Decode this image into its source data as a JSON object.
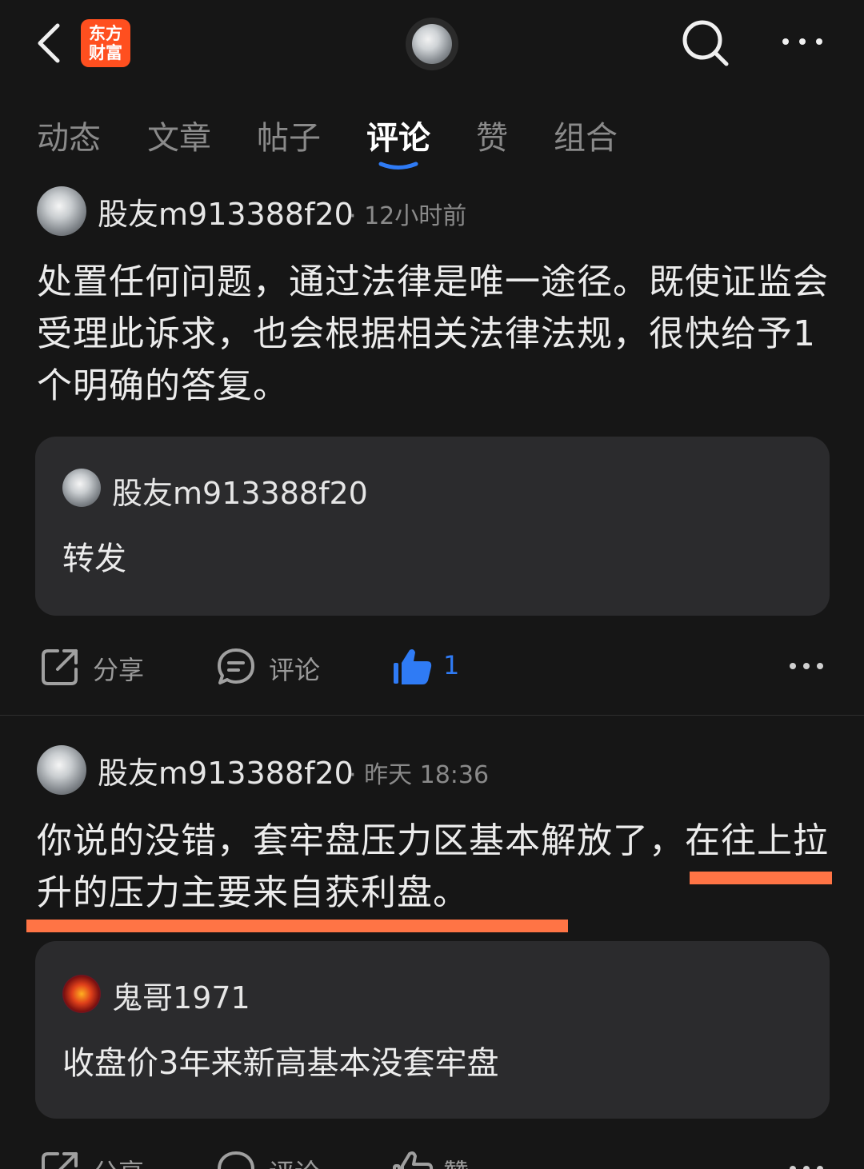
{
  "header": {
    "logo_line1": "东方",
    "logo_line2": "财富"
  },
  "tabs": [
    {
      "label": "动态"
    },
    {
      "label": "文章"
    },
    {
      "label": "帖子"
    },
    {
      "label": "评论",
      "active": true
    },
    {
      "label": "赞"
    },
    {
      "label": "组合"
    }
  ],
  "posts": [
    {
      "author": "股友m913388f20",
      "time": "· 12小时前",
      "text": "处置任何问题，通过法律是唯一途径。既使证监会受理此诉求，也会根据相关法律法规，很快给予1个明确的答复。",
      "quote": {
        "author": "股友m913388f20",
        "text": "转发"
      },
      "actions": {
        "share": "分享",
        "comment": "评论",
        "likes": "1"
      }
    },
    {
      "author": "股友m913388f20",
      "time": "· 昨天 18:36",
      "text": "你说的没错，套牢盘压力区基本解放了，在往上拉升的压力主要来自获利盘。",
      "quote": {
        "author": "鬼哥1971",
        "text": "收盘价3年来新高基本没套牢盘"
      },
      "actions": {
        "share": "分享",
        "comment": "评论",
        "likes": "赞"
      }
    }
  ],
  "colors": {
    "background": "#161616",
    "accent_blue": "#2f7bf5",
    "logo_orange": "#ff4f1f",
    "highlight_underline": "#ff7445"
  }
}
